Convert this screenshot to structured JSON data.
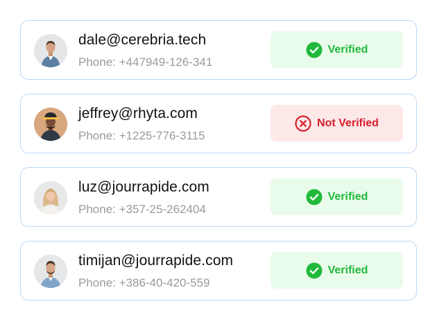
{
  "contacts": [
    {
      "email": "dale@cerebria.tech",
      "phone": "Phone: +447949-126-341",
      "status": "Verified",
      "status_icon": "check-circle-icon",
      "status_color": "#20b93b"
    },
    {
      "email": "jeffrey@rhyta.com",
      "phone": "Phone: +1225-776-3115",
      "status": "Not Verified",
      "status_icon": "x-circle-icon",
      "status_color": "#d71f2e"
    },
    {
      "email": "luz@jourrapide.com",
      "phone": "Phone: +357-25-262404",
      "status": "Verified",
      "status_icon": "check-circle-icon",
      "status_color": "#20b93b"
    },
    {
      "email": "timijan@jourrapide.com",
      "phone": "Phone: +386-40-420-559",
      "status": "Verified",
      "status_icon": "check-circle-icon",
      "status_color": "#20b93b"
    }
  ],
  "colors": {
    "card_border": "#bcd7f2",
    "verified_bg": "#e9fbea",
    "not_verified_bg": "#fde8e8"
  }
}
